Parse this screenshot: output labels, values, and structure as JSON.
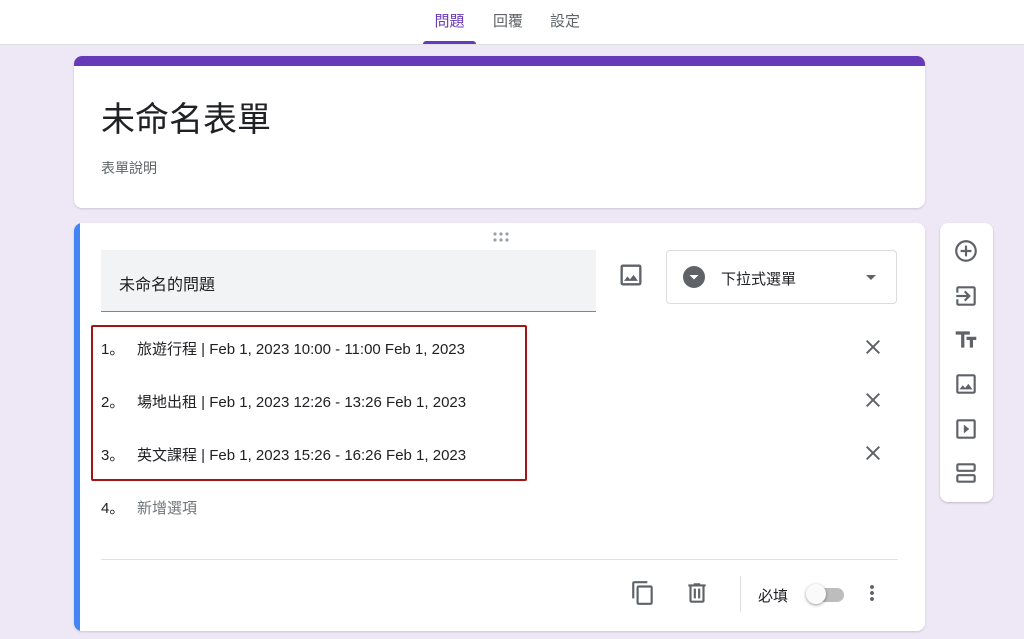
{
  "tabs": [
    {
      "label": "問題",
      "active": true
    },
    {
      "label": "回覆",
      "active": false
    },
    {
      "label": "設定",
      "active": false
    }
  ],
  "form": {
    "title": "未命名表單",
    "description": "表單說明",
    "accent_color": "#673ab7"
  },
  "question": {
    "title": "未命名的問題",
    "type_label": "下拉式選單",
    "options": [
      {
        "number": "1。",
        "text": "旅遊行程 | Feb 1, 2023 10:00 - 11:00 Feb 1, 2023"
      },
      {
        "number": "2。",
        "text": "場地出租 | Feb 1, 2023 12:26 - 13:26 Feb 1, 2023"
      },
      {
        "number": "3。",
        "text": "英文課程 | Feb 1, 2023 15:26 - 16:26 Feb 1, 2023"
      }
    ],
    "add_option": {
      "number": "4。",
      "placeholder": "新增選項"
    },
    "required_label": "必填",
    "required": false
  },
  "icons": {
    "question_image": "image-icon",
    "type": "dropdown-circle-icon",
    "remove": "close-icon",
    "copy": "copy-icon",
    "delete": "trash-icon",
    "more": "more-vert-icon",
    "side_toolbar": [
      "add-circle-icon",
      "import-icon",
      "title-icon",
      "image-icon",
      "video-icon",
      "section-icon"
    ]
  }
}
